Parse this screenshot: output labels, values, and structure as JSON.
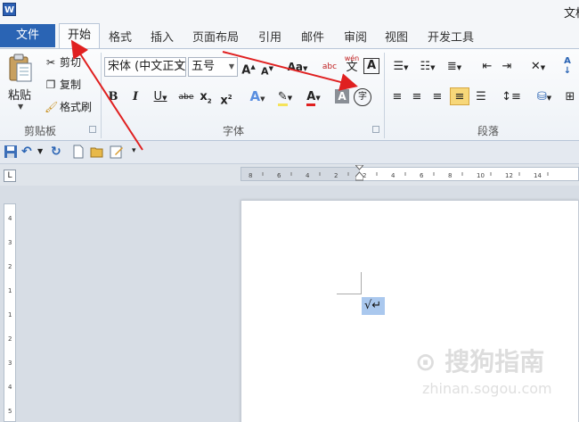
{
  "app": {
    "icon_letter": "W",
    "title_fragment": "文档"
  },
  "tabs": {
    "file": "文件",
    "home": "开始",
    "others": [
      "格式",
      "插入",
      "页面布局",
      "引用",
      "邮件",
      "审阅",
      "视图",
      "开发工具"
    ]
  },
  "clipboard": {
    "paste": "粘贴",
    "cut": "剪切",
    "copy": "复制",
    "format_painter": "格式刷",
    "group_label": "剪贴板"
  },
  "font": {
    "font_name": "宋体 (中文正文",
    "font_size": "五号",
    "grow": "A",
    "shrink": "A",
    "change_case": "Aa",
    "clear_format": "abc",
    "phonetic": "wén",
    "phonetic_char": "文",
    "char_border": "A",
    "bold": "B",
    "italic": "I",
    "underline": "U",
    "strikethrough": "abe",
    "subscript": "x",
    "superscript": "x",
    "text_effect": "A",
    "font_color": "A",
    "char_shading": "A",
    "enclose_char": "字",
    "group_label": "字体"
  },
  "paragraph": {
    "group_label": "段落",
    "sort": "A"
  },
  "ruler": {
    "h_marks": [
      "8",
      "6",
      "4",
      "2",
      "2",
      "4",
      "6",
      "8",
      "10",
      "12",
      "14"
    ],
    "v_marks": [
      "4",
      "3",
      "2",
      "1",
      "1",
      "2",
      "3",
      "4",
      "5"
    ]
  },
  "document": {
    "check_mark": "√↵"
  },
  "watermark": {
    "brand": "搜狗指南",
    "url": "zhinan.sogou.com"
  },
  "colors": {
    "file_tab": "#2a64b4",
    "annotation": "#e02020",
    "highlight_yellow": "#f5e35a",
    "font_red": "#e02020"
  }
}
